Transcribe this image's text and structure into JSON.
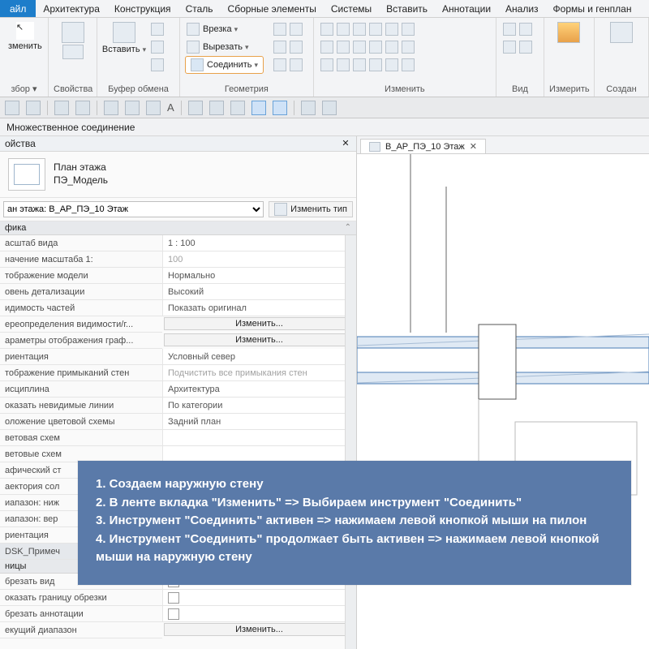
{
  "menus": {
    "file": "айл",
    "items": [
      "Архитектура",
      "Конструкция",
      "Сталь",
      "Сборные элементы",
      "Системы",
      "Вставить",
      "Аннотации",
      "Анализ",
      "Формы и генплан"
    ]
  },
  "ribbon": {
    "edit_group": "збор ▾",
    "edit_btn": "зменить",
    "props_group": "Свойства",
    "clipboard_group": "Буфер обмена",
    "paste": "Вставить",
    "cut": "Врезка",
    "cutout": "Вырезать",
    "join": "Соединить",
    "geometry_group": "Геометрия",
    "modify_group": "Изменить",
    "view_group": "Вид",
    "measure_group": "Измерить",
    "create_group": "Создан"
  },
  "modebar": "Множественное соединение",
  "props": {
    "title": "ойства",
    "type_name": "План этажа",
    "type_sub": "ПЭ_Модель",
    "selector": "ан этажа: В_АР_ПЭ_10 Этаж",
    "edit_type": "Изменить тип",
    "group1": "фика",
    "rows": [
      {
        "k": "асштаб вида",
        "v": "1 : 100",
        "editable": true
      },
      {
        "k": "начение масштаба    1:",
        "v": "100",
        "dim": true
      },
      {
        "k": "тображение модели",
        "v": "Нормально"
      },
      {
        "k": "овень детализации",
        "v": "Высокий"
      },
      {
        "k": "идимость частей",
        "v": "Показать оригинал"
      },
      {
        "k": "ереопределения видимости/г...",
        "v": "Изменить...",
        "btn": true
      },
      {
        "k": "араметры отображения граф...",
        "v": "Изменить...",
        "btn": true
      },
      {
        "k": "риентация",
        "v": "Условный север"
      },
      {
        "k": "тображение примыканий стен",
        "v": "Подчистить все примыкания стен",
        "dim": true
      },
      {
        "k": "исциплина",
        "v": "Архитектура"
      },
      {
        "k": "оказать невидимые линии",
        "v": "По категории"
      },
      {
        "k": "оложение цветовой схемы",
        "v": "Задний план"
      },
      {
        "k": "ветовая схем",
        "v": ""
      },
      {
        "k": "ветовые схем",
        "v": ""
      },
      {
        "k": "афический ст",
        "v": ""
      },
      {
        "k": "аектория сол",
        "v": ""
      },
      {
        "k": "иапазон: ниж",
        "v": ""
      },
      {
        "k": "иапазон: вер",
        "v": ""
      },
      {
        "k": "риентация",
        "v": ""
      },
      {
        "k": "DSK_Примеч",
        "v": "",
        "hl": true
      },
      {
        "k": "ницы",
        "v": "",
        "header": true
      },
      {
        "k": "брезать вид",
        "v": "",
        "chk": true
      },
      {
        "k": "оказать границу обрезки",
        "v": "",
        "chk": true
      },
      {
        "k": "брезать аннотации",
        "v": "",
        "chk": true
      },
      {
        "k": "екущий диапазон",
        "v": "Изменить...",
        "btn": true
      }
    ]
  },
  "view_tab": "В_АР_ПЭ_10 Этаж",
  "overlay": {
    "l1": "1. Создаем наружную стену",
    "l2": "2. В ленте вкладка \"Изменить\" => Выбираем инструмент \"Соединить\"",
    "l3": "3. Инструмент \"Соединить\" активен => нажимаем левой кнопкой мыши на пилон",
    "l4": "4. Инструмент \"Соединить\" продолжает быть активен => нажимаем левой кнопкой мыши на наружную стену"
  }
}
